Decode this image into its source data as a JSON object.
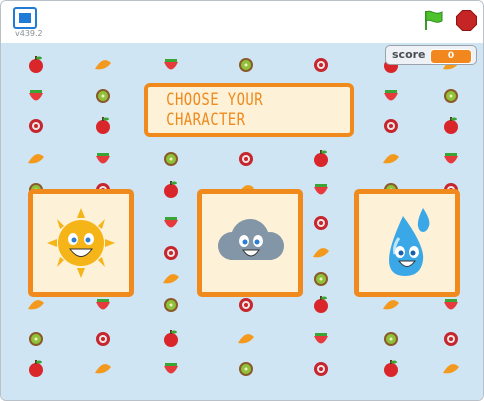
{
  "player": {
    "version": "v439.2"
  },
  "score": {
    "label": "score",
    "value": "0"
  },
  "title": {
    "text": "CHOOSE YOUR CHARACTER"
  },
  "characters": [
    {
      "name": "sun"
    },
    {
      "name": "cloud"
    },
    {
      "name": "water-drop"
    }
  ],
  "colors": {
    "stage": "#cfe5f3",
    "accent": "#f08a1c",
    "card": "#fdf1d8"
  }
}
